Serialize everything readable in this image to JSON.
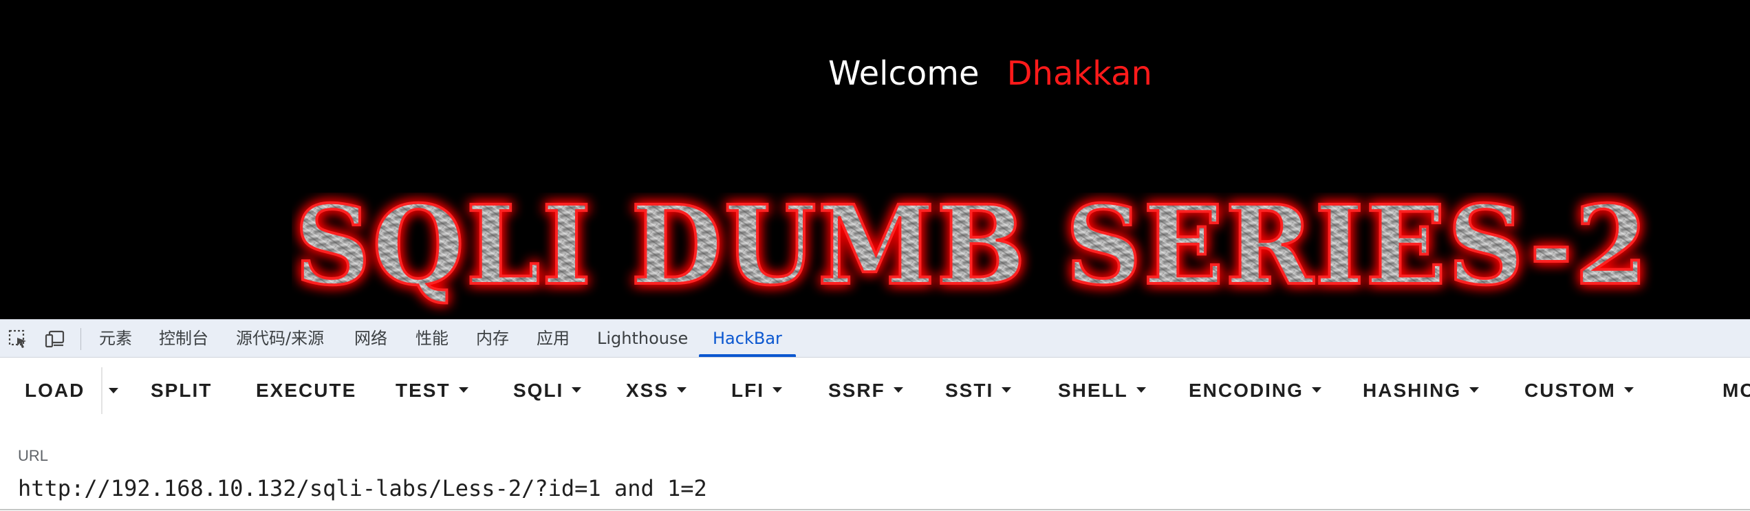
{
  "page": {
    "welcome_word": "Welcome",
    "welcome_name": "Dhakkan",
    "banner_text": "SQLI DUMB SERIES-2",
    "colors": {
      "background": "#000000",
      "welcome_text": "#ffffff",
      "name_text": "#ff1a1a",
      "banner_glow": "#ff0000"
    }
  },
  "devtools": {
    "icons": [
      "inspect-element-icon",
      "device-toolbar-icon"
    ],
    "tabs": [
      {
        "label": "元素"
      },
      {
        "label": "控制台"
      },
      {
        "label": "源代码/来源"
      },
      {
        "label": "网络"
      },
      {
        "label": "性能"
      },
      {
        "label": "内存"
      },
      {
        "label": "应用"
      },
      {
        "label": "Lighthouse"
      },
      {
        "label": "HackBar",
        "active": true
      }
    ],
    "accent_color": "#0b57d0"
  },
  "hackbar": {
    "buttons": [
      {
        "label": "LOAD"
      },
      {
        "label": "SPLIT"
      },
      {
        "label": "EXECUTE"
      },
      {
        "label": "TEST"
      },
      {
        "label": "SQLI"
      },
      {
        "label": "XSS"
      },
      {
        "label": "LFI"
      },
      {
        "label": "SSRF"
      },
      {
        "label": "SSTI"
      },
      {
        "label": "SHELL"
      },
      {
        "label": "ENCODING"
      },
      {
        "label": "HASHING"
      },
      {
        "label": "CUSTOM"
      },
      {
        "label": "MC"
      }
    ],
    "url_label": "URL",
    "url_value": "http://192.168.10.132/sqli-labs/Less-2/?id=1 and 1=2"
  }
}
